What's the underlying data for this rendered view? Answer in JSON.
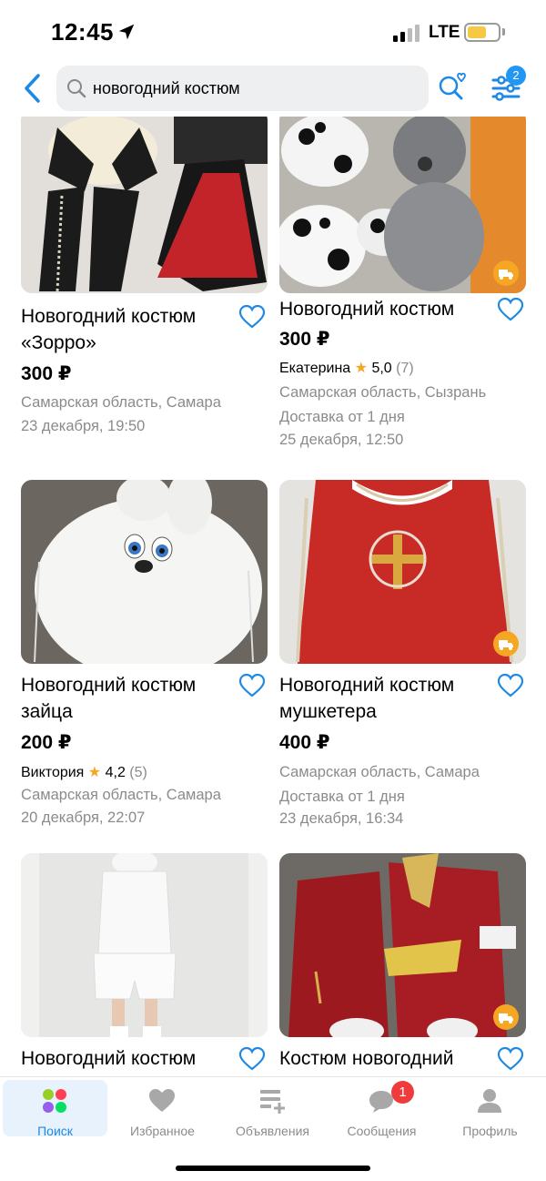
{
  "status": {
    "time": "12:45",
    "network": "LTE"
  },
  "search": {
    "query": "новогодний костюм"
  },
  "filters": {
    "badge": "2"
  },
  "listings": [
    {
      "title": "Новогодний костюм «Зорро»",
      "price": "300 ₽",
      "location": "Самарская область, Самара",
      "date": "23 декабря, 19:50"
    },
    {
      "title": "Новогодний костюм",
      "price": "300 ₽",
      "seller": "Екатерина",
      "rating": "5,0",
      "reviews": "(7)",
      "location": "Самарская область, Сызрань",
      "delivery": "Доставка от 1 дня",
      "date": "25 декабря, 12:50"
    },
    {
      "title": "Новогодний костюм зайца",
      "price": "200 ₽",
      "seller": "Виктория",
      "rating": "4,2",
      "reviews": "(5)",
      "location": "Самарская область, Самара",
      "date": "20 декабря, 22:07"
    },
    {
      "title": "Новогодний костюм мушкетера",
      "price": "400 ₽",
      "location": "Самарская область, Самара",
      "delivery": "Доставка от 1 дня",
      "date": "23 декабря, 16:34"
    },
    {
      "title": "Новогодний костюм"
    },
    {
      "title": "Костюм новогодний"
    }
  ],
  "tabs": [
    {
      "label": "Поиск"
    },
    {
      "label": "Избранное"
    },
    {
      "label": "Объявления"
    },
    {
      "label": "Сообщения",
      "badge": "1"
    },
    {
      "label": "Профиль"
    }
  ],
  "colors": {
    "accent": "#1e88e5",
    "price": "#000000",
    "meta": "#8b8b8b",
    "star": "#f5a623",
    "badge": "#ef3b3b"
  }
}
